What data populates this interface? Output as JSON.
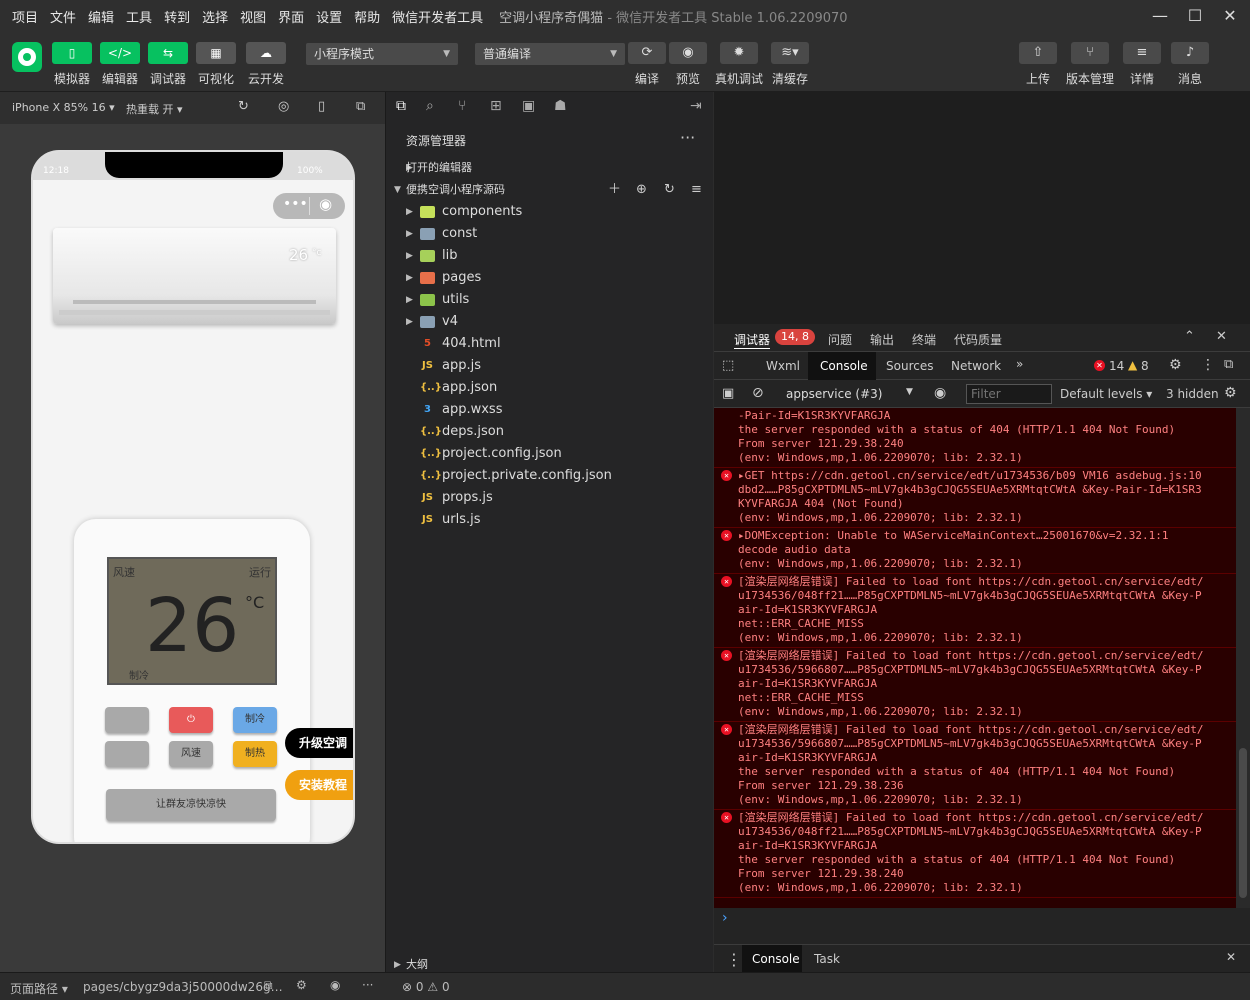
{
  "menubar": {
    "items": [
      "项目",
      "文件",
      "编辑",
      "工具",
      "转到",
      "选择",
      "视图",
      "界面",
      "设置",
      "帮助",
      "微信开发者工具"
    ],
    "title": "空调小程序奇偶猫",
    "title_suffix": " - 微信开发者工具 Stable 1.06.2209070"
  },
  "toolbar": {
    "left_buttons": [
      {
        "label": "模拟器",
        "icon": "phone-icon"
      },
      {
        "label": "编辑器",
        "icon": "code-icon"
      },
      {
        "label": "调试器",
        "icon": "sliders-icon"
      },
      {
        "label": "可视化",
        "icon": "layout-icon"
      },
      {
        "label": "云开发",
        "icon": "cloud-icon"
      }
    ],
    "mode_select": "小程序模式",
    "compile_select": "普通编译",
    "mid_buttons": [
      {
        "label": "编译",
        "icon": "refresh-icon"
      },
      {
        "label": "预览",
        "icon": "eye-icon"
      },
      {
        "label": "真机调试",
        "icon": "bug-icon"
      },
      {
        "label": "清缓存",
        "icon": "layers-icon"
      }
    ],
    "right_buttons": [
      {
        "label": "上传",
        "icon": "upload-icon"
      },
      {
        "label": "版本管理",
        "icon": "branch-icon"
      },
      {
        "label": "详情",
        "icon": "menu-icon"
      },
      {
        "label": "消息",
        "icon": "bell-icon"
      }
    ]
  },
  "simbar": {
    "device": "iPhone X 85% 16",
    "hot_reload": "热重载 开"
  },
  "phone": {
    "time": "12:18",
    "battery": "100%",
    "ac_temp": "26",
    "ac_unit": "°c",
    "lcd": {
      "wind": "风速",
      "run": "运行",
      "temp": "26",
      "unit": "°C",
      "mode": "制冷"
    },
    "buttons": {
      "cool": "制冷",
      "wind": "风速",
      "heat": "制热",
      "share": "让群友凉快凉快"
    },
    "pill_upgrade": "升级空调",
    "pill_tutorial": "安装教程"
  },
  "explorer": {
    "header": "资源管理器",
    "open_editors": "打开的编辑器",
    "project": "便携空调小程序源码",
    "outline": "大纲",
    "files": [
      {
        "name": "components",
        "type": "folder",
        "icon": "folder-icon",
        "color": "#c5e05a",
        "label": "▪"
      },
      {
        "name": "const",
        "type": "folder",
        "icon": "folder-icon",
        "color": "#8aa0b4",
        "label": ""
      },
      {
        "name": "lib",
        "type": "folder",
        "icon": "folder-icon",
        "color": "#a6d05a",
        "label": ""
      },
      {
        "name": "pages",
        "type": "folder",
        "icon": "folder-icon",
        "color": "#e8704a",
        "label": ""
      },
      {
        "name": "utils",
        "type": "folder",
        "icon": "folder-icon",
        "color": "#8cc34a",
        "label": ""
      },
      {
        "name": "v4",
        "type": "folder",
        "icon": "folder-icon",
        "color": "#8aa0b4",
        "label": ""
      },
      {
        "name": "404.html",
        "type": "file",
        "icon": "html-icon",
        "color": "#e44d26",
        "label": "5"
      },
      {
        "name": "app.js",
        "type": "file",
        "icon": "js-icon",
        "color": "#f0c040",
        "label": "JS"
      },
      {
        "name": "app.json",
        "type": "file",
        "icon": "json-icon",
        "color": "#f0c040",
        "label": "{..}"
      },
      {
        "name": "app.wxss",
        "type": "file",
        "icon": "css-icon",
        "color": "#42a5f5",
        "label": "3"
      },
      {
        "name": "deps.json",
        "type": "file",
        "icon": "json-icon",
        "color": "#f0c040",
        "label": "{..}"
      },
      {
        "name": "project.config.json",
        "type": "file",
        "icon": "json-icon",
        "color": "#f0c040",
        "label": "{..}"
      },
      {
        "name": "project.private.config.json",
        "type": "file",
        "icon": "json-icon",
        "color": "#f0c040",
        "label": "{..}"
      },
      {
        "name": "props.js",
        "type": "file",
        "icon": "js-icon",
        "color": "#f0c040",
        "label": "JS"
      },
      {
        "name": "urls.js",
        "type": "file",
        "icon": "js-icon",
        "color": "#f0c040",
        "label": "JS"
      }
    ]
  },
  "devtools": {
    "top_tabs": [
      "调试器",
      "问题",
      "输出",
      "终端",
      "代码质量"
    ],
    "badge": "14, 8",
    "tabs": [
      "Wxml",
      "Console",
      "Sources",
      "Network"
    ],
    "errors": "14",
    "warnings": "8",
    "context": "appservice (#3)",
    "filter_placeholder": "Filter",
    "levels": "Default levels",
    "hidden": "3 hidden",
    "messages": [
      {
        "lines": [
          "-Pair-Id=K1SR3KYVFARGJA",
          "the server responded with a status of 404 (HTTP/1.1 404 Not Found)",
          "From server 121.29.38.240",
          "(env: Windows,mp,1.06.2209070; lib: 2.32.1)"
        ]
      },
      {
        "lines": [
          "▸GET https://cdn.getool.cn/service/edt/u1734536/b09  VM16 asdebug.js:10",
          "dbd2……P85gCXPTDMLN5~mLV7gk4b3gCJQG5SEUAe5XRMtqtCWtA  &Key-Pair-Id=K1SR3",
          "KYVFARGJA 404 (Not Found)",
          "(env: Windows,mp,1.06.2209070; lib: 2.32.1)"
        ]
      },
      {
        "lines": [
          "▸DOMException: Unable to       WAServiceMainContext…25001670&v=2.32.1:1",
          "decode audio data",
          "(env: Windows,mp,1.06.2209070; lib: 2.32.1)"
        ]
      },
      {
        "lines": [
          "[渲染层网络层错误] Failed to load font https://cdn.getool.cn/service/edt/",
          "u1734536/048ff21……P85gCXPTDMLN5~mLV7gk4b3gCJQG5SEUAe5XRMtqtCWtA  &Key-P",
          "air-Id=K1SR3KYVFARGJA",
          "net::ERR_CACHE_MISS",
          "(env: Windows,mp,1.06.2209070; lib: 2.32.1)"
        ]
      },
      {
        "lines": [
          "[渲染层网络层错误] Failed to load font https://cdn.getool.cn/service/edt/",
          "u1734536/5966807……P85gCXPTDMLN5~mLV7gk4b3gCJQG5SEUAe5XRMtqtCWtA  &Key-P",
          "air-Id=K1SR3KYVFARGJA",
          "net::ERR_CACHE_MISS",
          "(env: Windows,mp,1.06.2209070; lib: 2.32.1)"
        ]
      },
      {
        "lines": [
          "[渲染层网络层错误] Failed to load font https://cdn.getool.cn/service/edt/",
          "u1734536/5966807……P85gCXPTDMLN5~mLV7gk4b3gCJQG5SEUAe5XRMtqtCWtA  &Key-P",
          "air-Id=K1SR3KYVFARGJA",
          "the server responded with a status of 404 (HTTP/1.1 404 Not Found)",
          "From server 121.29.38.236",
          "(env: Windows,mp,1.06.2209070; lib: 2.32.1)"
        ]
      },
      {
        "lines": [
          "[渲染层网络层错误] Failed to load font https://cdn.getool.cn/service/edt/",
          "u1734536/048ff21……P85gCXPTDMLN5~mLV7gk4b3gCJQG5SEUAe5XRMtqtCWtA  &Key-P",
          "air-Id=K1SR3KYVFARGJA",
          "the server responded with a status of 404 (HTTP/1.1 404 Not Found)",
          "From server 121.29.38.240",
          "(env: Windows,mp,1.06.2209070; lib: 2.32.1)"
        ]
      }
    ],
    "prompt": "›",
    "bottom_tabs": [
      "Console",
      "Task"
    ]
  },
  "footer": {
    "path_label": "页面路径",
    "path": "pages/cbygz9da3j50000dw26g…",
    "errors": "0",
    "warnings": "0"
  }
}
